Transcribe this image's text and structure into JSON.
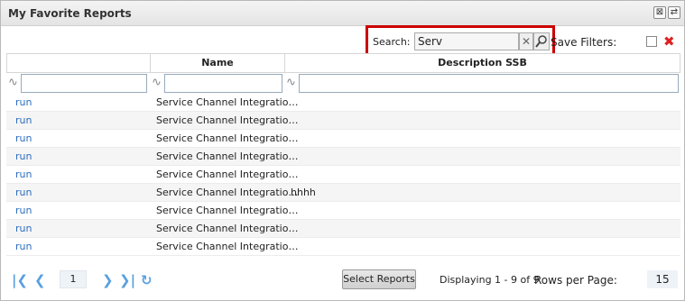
{
  "window": {
    "title": "My Favorite Reports"
  },
  "toolbar": {
    "search_label": "Search:",
    "search_value": "Serv",
    "clear_glyph": "✕",
    "save_filters_label": "Save Filters:"
  },
  "columns": [
    {
      "label": ""
    },
    {
      "label": "Name"
    },
    {
      "label": "Description SSB"
    }
  ],
  "rows": [
    {
      "action": "run",
      "name": "Service Channel Integratio…",
      "description": ""
    },
    {
      "action": "run",
      "name": "Service Channel Integratio…",
      "description": ""
    },
    {
      "action": "run",
      "name": "Service Channel Integratio…",
      "description": ""
    },
    {
      "action": "run",
      "name": "Service Channel Integratio…",
      "description": ""
    },
    {
      "action": "run",
      "name": "Service Channel Integratio…",
      "description": ""
    },
    {
      "action": "run",
      "name": "Service Channel Integratio…",
      "description": "hhhh"
    },
    {
      "action": "run",
      "name": "Service Channel Integratio…",
      "description": ""
    },
    {
      "action": "run",
      "name": "Service Channel Integratio…",
      "description": ""
    },
    {
      "action": "run",
      "name": "Service Channel Integratio…",
      "description": ""
    }
  ],
  "footer": {
    "page": "1",
    "select_reports_label": "Select Reports",
    "displaying": "Displaying 1 - 9 of 9",
    "rows_per_page_label": "Rows per Page:",
    "rows_per_page_value": "15"
  },
  "colors": {
    "link": "#2d6dbe",
    "highlight": "#cc0000",
    "pager_icon": "#5aa0e0"
  },
  "icons": [
    "maximize-icon",
    "refresh-icon",
    "clear-icon",
    "search-icon",
    "delete-icon",
    "first-page-icon",
    "prev-page-icon",
    "next-page-icon",
    "last-page-icon",
    "reload-icon"
  ]
}
